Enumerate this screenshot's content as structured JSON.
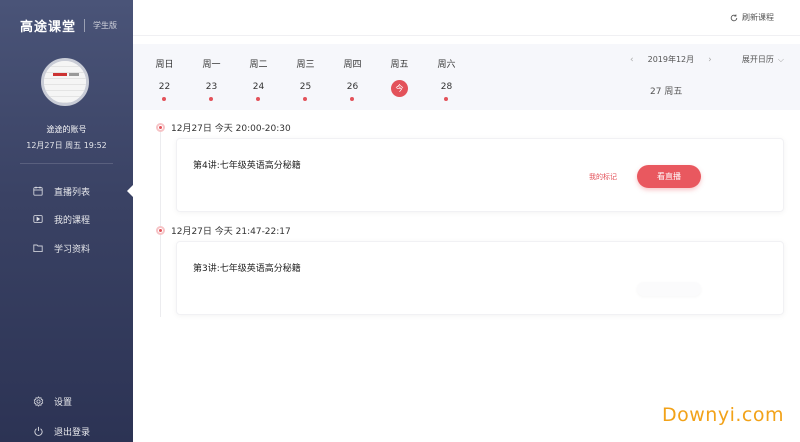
{
  "sidebar": {
    "brand_name": "高途课堂",
    "brand_sub": "学生版",
    "account_name": "途途的账号",
    "account_time": "12月27日 周五 19:52",
    "nav": [
      {
        "label": "直播列表",
        "icon": "calendar-icon",
        "active": true
      },
      {
        "label": "我的课程",
        "icon": "play-icon",
        "active": false
      },
      {
        "label": "学习资料",
        "icon": "folder-icon",
        "active": false
      }
    ],
    "settings_label": "设置",
    "logout_label": "退出登录"
  },
  "header": {
    "refresh_label": "刷新课程",
    "refresh_icon": "refresh-icon"
  },
  "calendar": {
    "days": [
      {
        "name": "周日",
        "num": "22",
        "has_class": true,
        "today": false
      },
      {
        "name": "周一",
        "num": "23",
        "has_class": true,
        "today": false
      },
      {
        "name": "周二",
        "num": "24",
        "has_class": true,
        "today": false
      },
      {
        "name": "周三",
        "num": "25",
        "has_class": true,
        "today": false
      },
      {
        "name": "周四",
        "num": "26",
        "has_class": true,
        "today": false
      },
      {
        "name": "周五",
        "num": "今",
        "has_class": false,
        "today": true
      },
      {
        "name": "周六",
        "num": "28",
        "has_class": true,
        "today": false
      }
    ],
    "month_label": "2019年12月",
    "prev_arrow": "‹",
    "next_arrow": "›",
    "expand_label": "展开日历",
    "selected_date": "27 周五"
  },
  "sessions": [
    {
      "time": "12月27日 今天 20:00-20:30",
      "title": "第4讲:七年级英语高分秘籍",
      "mark_label": "我的标记",
      "action_label": "看直播"
    },
    {
      "time": "12月27日 今天 21:47-22:17",
      "title": "第3讲:七年级英语高分秘籍"
    }
  ],
  "colors": {
    "accent": "#e3525a",
    "sidebar": "#3a4264"
  },
  "watermark": "Downyi.com"
}
